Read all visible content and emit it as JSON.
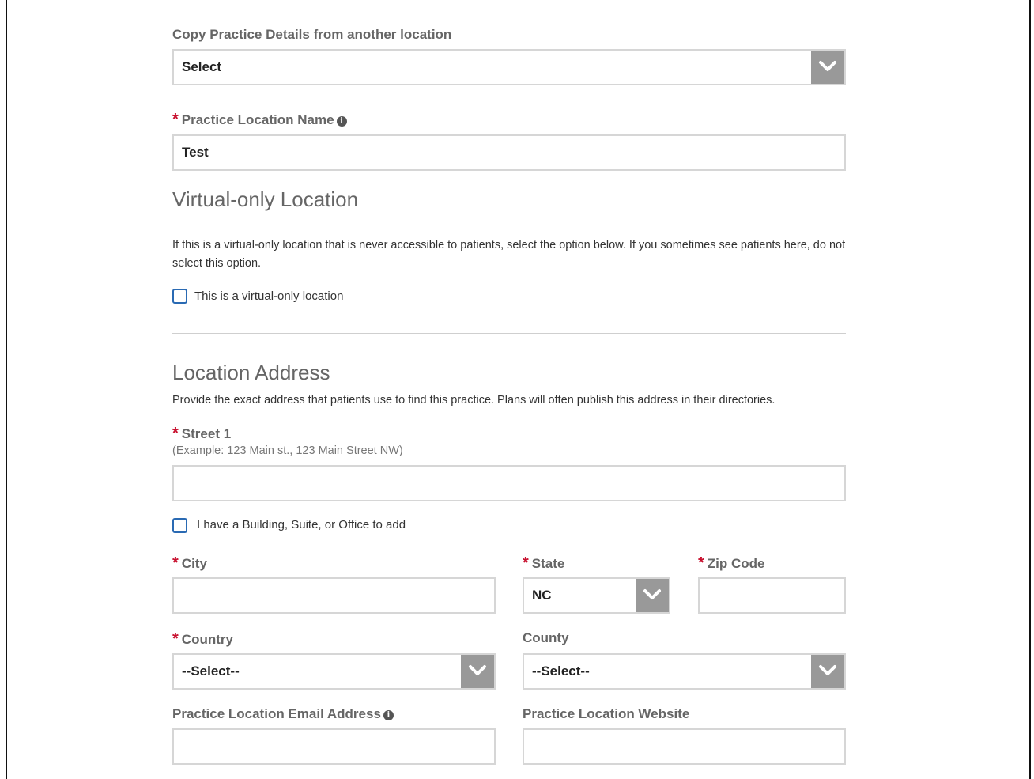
{
  "copy_details": {
    "label": "Copy Practice Details from another location",
    "value": "Select"
  },
  "practice_name": {
    "label": "Practice Location Name",
    "value": "Test"
  },
  "virtual": {
    "heading": "Virtual-only Location",
    "description": "If this is a virtual-only location that is never accessible to patients, select the option below. If you sometimes see patients here, do not select this option.",
    "checkbox_label": "This is a virtual-only location",
    "checked": false
  },
  "address": {
    "heading": "Location Address",
    "description": "Provide the exact address that patients use to find this practice. Plans will often publish this address in their directories.",
    "street1": {
      "label": "Street 1",
      "hint": "(Example: 123 Main st., 123 Main Street NW)",
      "value": ""
    },
    "suite_checkbox_label": "I have a Building, Suite, or Office to add",
    "city": {
      "label": "City",
      "value": ""
    },
    "state": {
      "label": "State",
      "value": "NC"
    },
    "zip": {
      "label": "Zip Code",
      "value": ""
    },
    "country": {
      "label": "Country",
      "value": "--Select--"
    },
    "county": {
      "label": "County",
      "value": "--Select--"
    },
    "email": {
      "label": "Practice Location Email Address",
      "value": ""
    },
    "website": {
      "label": "Practice Location Website",
      "value": ""
    }
  },
  "icons": {
    "required": "*",
    "info": "i"
  },
  "colors": {
    "required": "#c8102e",
    "checkbox_border": "#2a6ab3",
    "dropdown_button": "#999999"
  }
}
